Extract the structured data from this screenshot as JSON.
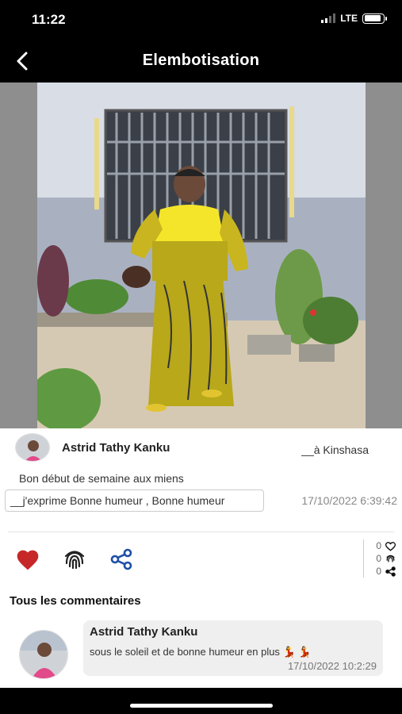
{
  "status_bar": {
    "time": "11:22",
    "network": "LTE",
    "battery_level": 0.9
  },
  "navbar": {
    "title": "Elembotisation",
    "back_icon": "chevron-left-icon"
  },
  "post": {
    "author": "Astrid Tathy Kanku",
    "location": "__à Kinshasa",
    "caption": "Bon début de semaine aux miens",
    "mood": "__j'exprime Bonne humeur , Bonne humeur",
    "date": "17/10/2022 6:39:42",
    "counts": {
      "likes": "0",
      "fingerprints": "0",
      "shares": "0"
    }
  },
  "actions": {
    "like_icon": "heart-icon",
    "react_icon": "fingerprint-icon",
    "share_icon": "share-icon",
    "like_color": "#c62828",
    "share_color": "#1e4fa8"
  },
  "comments": {
    "title": "Tous les commentaires",
    "items": [
      {
        "author": "Astrid Tathy Kanku",
        "text": "sous le soleil et de bonne humeur en plus 💃 💃",
        "date": "17/10/2022 10:2:29"
      }
    ]
  }
}
